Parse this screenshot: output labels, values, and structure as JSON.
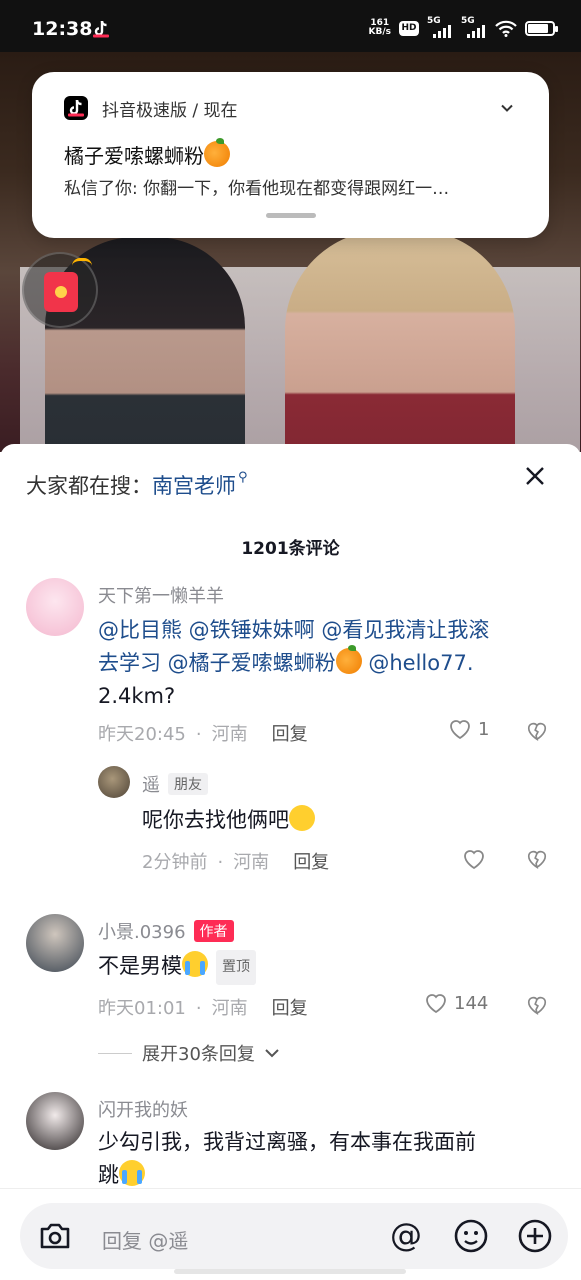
{
  "status_bar": {
    "time": "12:38",
    "net_speed_value": "161",
    "net_speed_unit": "KB/s",
    "hd_label": "HD",
    "sim1_label": "5G",
    "sim2_label": "5G",
    "battery_level": 0.85
  },
  "notification": {
    "app_name": "抖音极速版 / 现在",
    "title": "橘子爱嗦螺蛳粉",
    "body": "私信了你: 你翻一下，你看他现在都变得跟网红一…"
  },
  "sheet": {
    "search_prefix": "大家都在搜：",
    "search_keyword": "南宫老师",
    "comment_count": "1201条评论"
  },
  "comments": [
    {
      "username": "天下第一懒羊羊",
      "text_line1_mentions": "@比目熊 @铁锤妹妹啊 @看见我清让我滚",
      "text_line2_a": "去学习 @橘子爱嗦螺蛳粉",
      "text_line2_b": " @hello77.",
      "text_line3": "2.4km?",
      "time": "昨天20:45",
      "location": "河南",
      "reply_label": "回复",
      "likes": "1"
    },
    {
      "username": "遥",
      "badge": "朋友",
      "text": "呢你去找他俩吧",
      "time": "2分钟前",
      "location": "河南",
      "reply_label": "回复"
    },
    {
      "username": "小景.0396",
      "badge": "作者",
      "text": "不是男模",
      "pin_label": "置顶",
      "time": "昨天01:01",
      "location": "河南",
      "reply_label": "回复",
      "likes": "144",
      "expand_label": "展开30条回复"
    },
    {
      "username": "闪开我的妖",
      "text_line1": "少勾引我，我背过离骚，有本事在我面前",
      "text_line2": "跳"
    }
  ],
  "input_bar": {
    "placeholder": "回复 @遥",
    "icons": [
      "camera-icon",
      "at-icon",
      "emoji-icon",
      "plus-icon"
    ]
  },
  "colors": {
    "mention_blue": "#1e4d8c",
    "author_badge": "#fe2c55"
  }
}
